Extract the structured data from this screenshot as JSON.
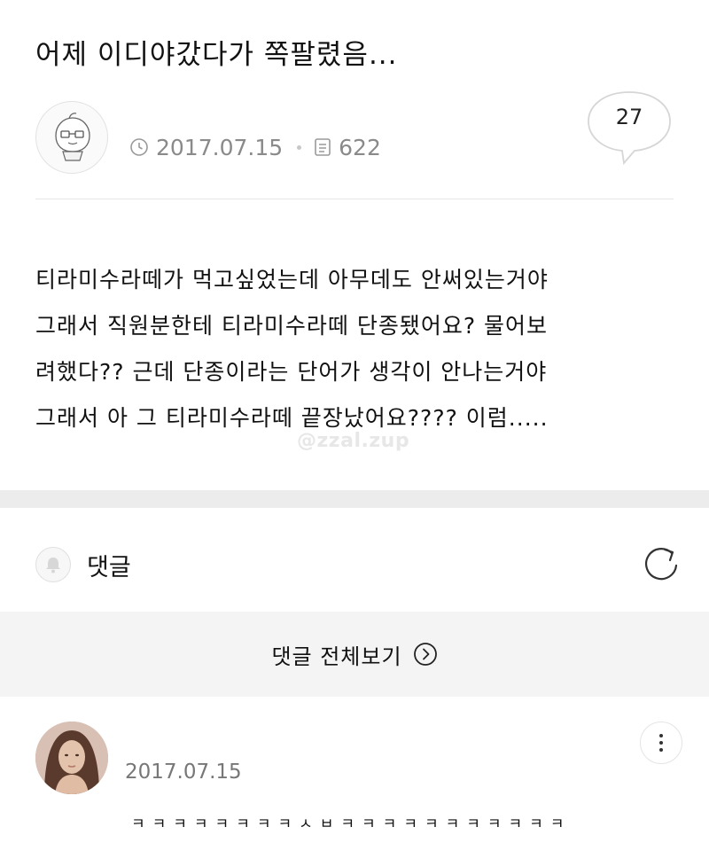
{
  "post": {
    "title": "어제 이디야갔다가 쪽팔렸음...",
    "date": "2017.07.15",
    "views": "622",
    "comment_count": "27",
    "body": [
      "티라미수라떼가 먹고싶었는데 아무데도 안써있는거야",
      "그래서 직원분한테 티라미수라떼 단종됐어요? 물어보",
      "려했다?? 근데 단종이라는 단어가 생각이 안나는거야",
      "그래서 아 그 티라미수라떼 끝장났어요???? 이럼....."
    ]
  },
  "watermark": "@zzal.zup",
  "comments": {
    "header_label": "댓글",
    "view_all_label": "댓글 전체보기",
    "items": [
      {
        "date": "2017.07.15",
        "text": "ㅋㅋㅋㅋㅋㅋㅋㅋㅅㅂㅋㅋㅋㅋㅋㅋㅋㅋㅋㅋㅋ"
      }
    ]
  },
  "icons": {
    "author_avatar": "peach-character-avatar",
    "date": "clock-icon",
    "views": "document-icon",
    "comment_count": "speech-bubble-icon",
    "comments_header": "bell-icon",
    "refresh": "refresh-icon",
    "view_all": "chevron-right-circle-icon",
    "more": "more-vertical-icon"
  },
  "colors": {
    "text": "#111111",
    "meta": "#8a8a8a",
    "band": "#ececec",
    "view_all_bg": "#f4f4f4"
  }
}
